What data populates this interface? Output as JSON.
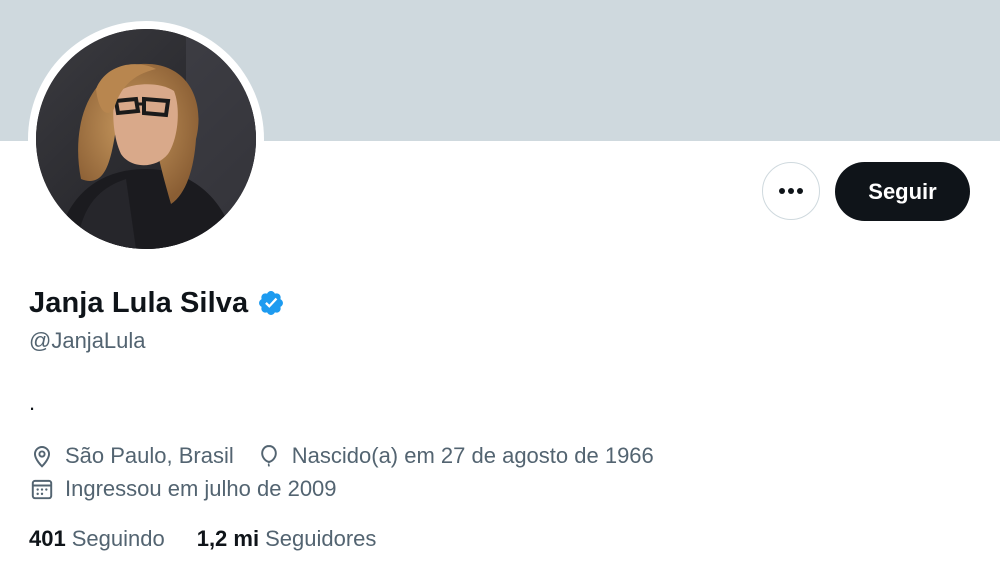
{
  "profile": {
    "display_name": "Janja Lula Silva",
    "handle": "@JanjaLula",
    "bio": ".",
    "location": "São Paulo, Brasil",
    "birth": "Nascido(a) em 27 de agosto de 1966",
    "joined": "Ingressou em julho de 2009",
    "verified": true
  },
  "actions": {
    "more_label": "•••",
    "follow_label": "Seguir"
  },
  "stats": {
    "following_count": "401",
    "following_label": "Seguindo",
    "followers_count": "1,2 mi",
    "followers_label": "Seguidores"
  },
  "icons": {
    "verified": "verified-badge-icon",
    "location": "location-pin-icon",
    "birth": "balloon-icon",
    "joined": "calendar-icon"
  },
  "colors": {
    "banner": "#cfd9de",
    "primary_text": "#0f1419",
    "secondary_text": "#536471",
    "verified_blue": "#1d9bf0",
    "follow_button": "#0f1419"
  }
}
